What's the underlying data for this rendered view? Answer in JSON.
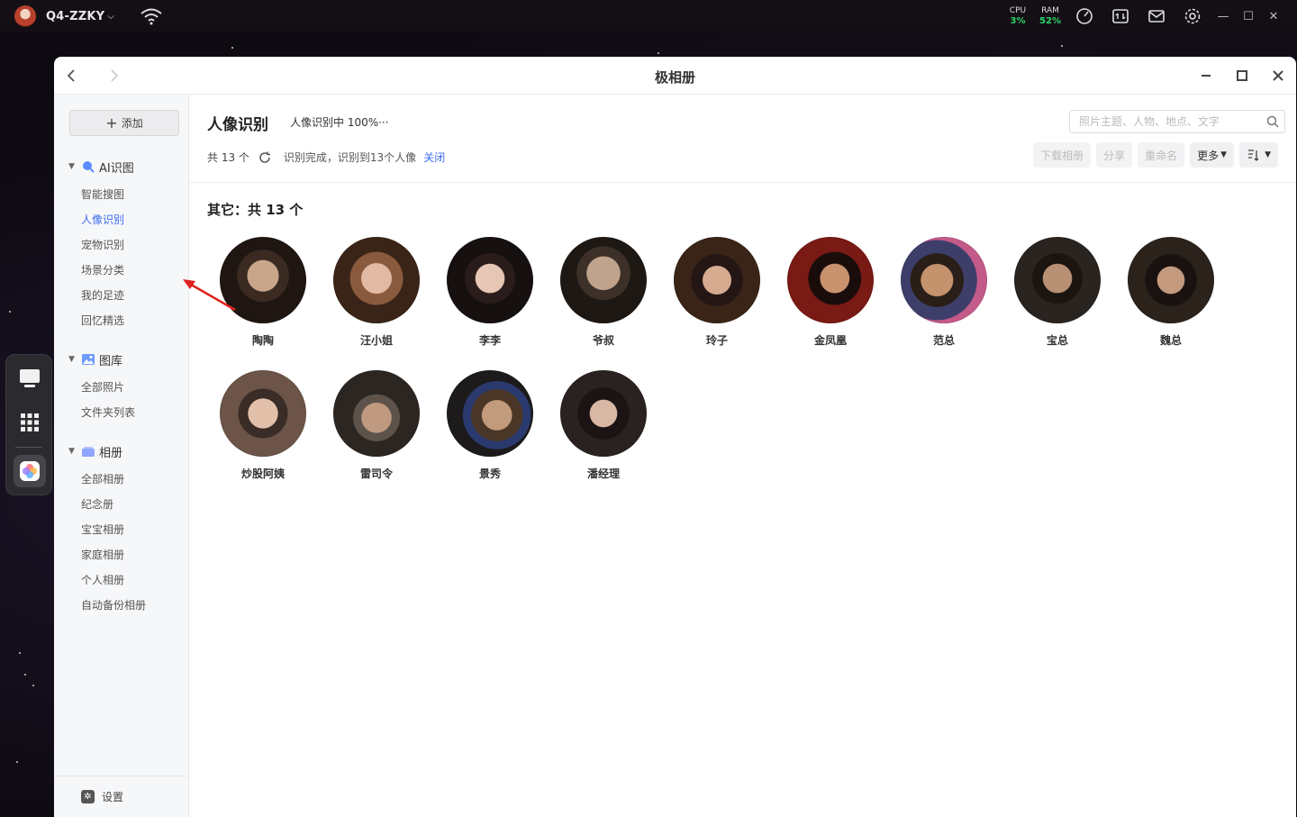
{
  "system": {
    "host_name": "Q4-ZZKY",
    "cpu_label": "CPU",
    "cpu_value": "3%",
    "ram_label": "RAM",
    "ram_value": "52%",
    "accent_ok": "#2bd66b"
  },
  "window": {
    "title": "极相册"
  },
  "sidebar": {
    "add_label": "添加",
    "sections": [
      {
        "label": "AI识图",
        "icon": "magnifier-icon"
      },
      {
        "label": "图库",
        "icon": "image-icon"
      },
      {
        "label": "相册",
        "icon": "album-icon"
      }
    ],
    "ai_items": [
      "智能搜图",
      "人像识别",
      "宠物识别",
      "场景分类",
      "我的足迹",
      "回忆精选"
    ],
    "gallery_items": [
      "全部照片",
      "文件夹列表"
    ],
    "album_items": [
      "全部相册",
      "纪念册",
      "宝宝相册",
      "家庭相册",
      "个人相册",
      "自动备份相册"
    ],
    "active_item": "人像识别",
    "settings_label": "设置"
  },
  "content": {
    "title": "人像识别",
    "progress": "人像识别中 100%···",
    "search_placeholder": "照片主题、人物、地点、文字",
    "count": "共 13 个",
    "status": "识别完成，识别到13个人像",
    "close_label": "关闭",
    "toolbar": {
      "download": "下载相册",
      "share": "分享",
      "rename": "重命名",
      "more": "更多"
    },
    "group_title": "其它：共 13 个",
    "people": [
      {
        "name": "陶陶"
      },
      {
        "name": "汪小姐"
      },
      {
        "name": "李李"
      },
      {
        "name": "爷叔"
      },
      {
        "name": "玲子"
      },
      {
        "name": "金凤凰"
      },
      {
        "name": "范总"
      },
      {
        "name": "宝总"
      },
      {
        "name": "魏总"
      },
      {
        "name": "炒股阿姨"
      },
      {
        "name": "雷司令"
      },
      {
        "name": "景秀"
      },
      {
        "name": "潘经理"
      }
    ]
  },
  "colors": {
    "accent": "#3d6df0",
    "annotation": "#e0201c"
  }
}
